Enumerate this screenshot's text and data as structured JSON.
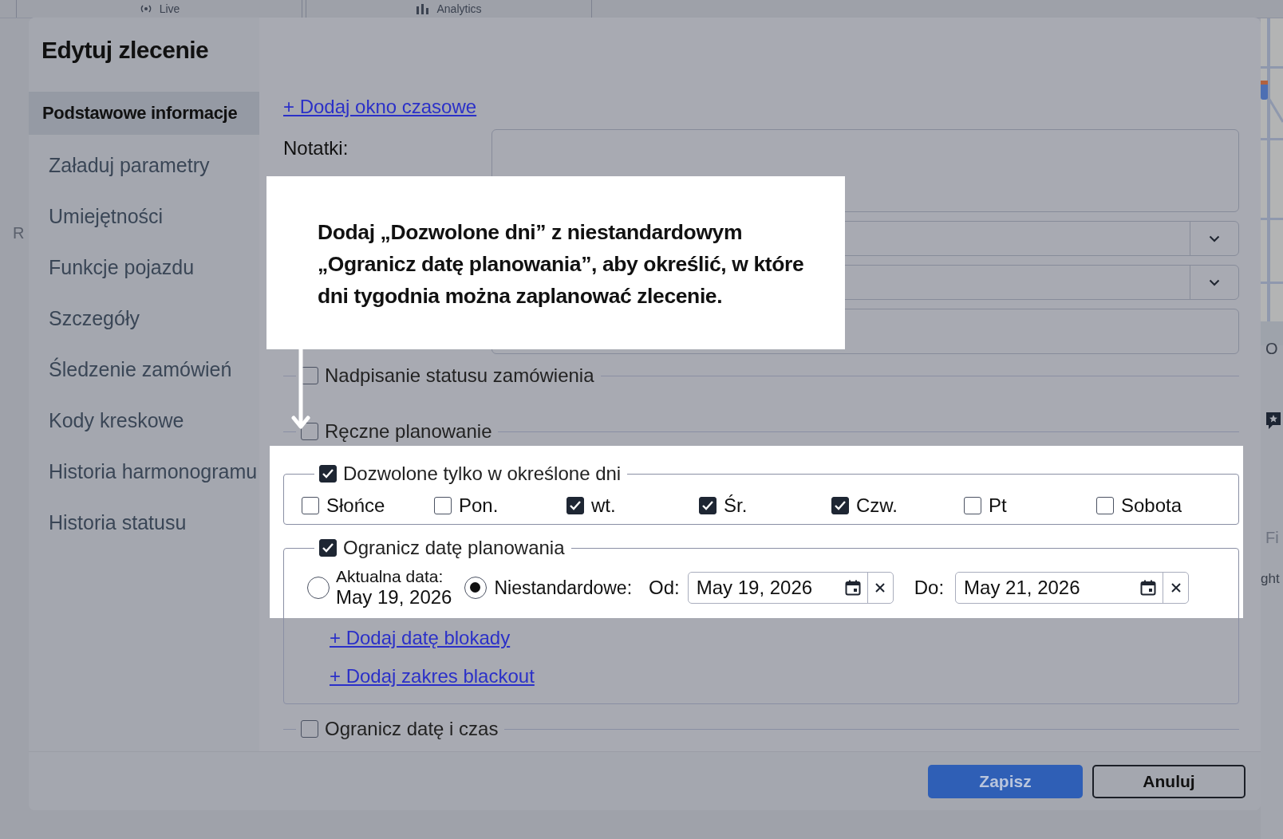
{
  "background": {
    "tabs": [
      {
        "label": "Live"
      },
      {
        "label": "Analytics"
      }
    ],
    "left_fragments": [
      "R"
    ],
    "right_fragments": [
      "O",
      "Fi",
      "ght"
    ]
  },
  "dialog": {
    "title": "Edytuj zlecenie",
    "sidebar": {
      "items": [
        {
          "label": "Podstawowe informacje",
          "selected": true
        },
        {
          "label": "Załaduj parametry",
          "selected": false
        },
        {
          "label": "Umiejętności",
          "selected": false
        },
        {
          "label": "Funkcje pojazdu",
          "selected": false
        },
        {
          "label": "Szczegóły",
          "selected": false
        },
        {
          "label": "Śledzenie zamówień",
          "selected": false
        },
        {
          "label": "Kody kreskowe",
          "selected": false
        },
        {
          "label": "Historia harmonogramu",
          "selected": false
        },
        {
          "label": "Historia statusu",
          "selected": false
        }
      ]
    },
    "add_time_window": "+ Dodaj okno czasowe",
    "notes_label": "Notatki:",
    "fields": [
      {
        "kind": "select"
      },
      {
        "kind": "select"
      },
      {
        "kind": "input"
      }
    ],
    "sections": [
      {
        "kind": "plain",
        "label": "Nadpisanie statusu zamówienia",
        "checked": false
      },
      {
        "kind": "plain",
        "label": "Ręczne planowanie",
        "checked": false
      },
      {
        "kind": "days",
        "label": "Dozwolone tylko w określone dni",
        "checked": true,
        "days": [
          {
            "label": "Słońce",
            "checked": false
          },
          {
            "label": "Pon.",
            "checked": false
          },
          {
            "label": "wt.",
            "checked": true
          },
          {
            "label": "Śr.",
            "checked": true
          },
          {
            "label": "Czw.",
            "checked": true
          },
          {
            "label": "Pt",
            "checked": false
          },
          {
            "label": "Sobota",
            "checked": false
          }
        ]
      },
      {
        "kind": "date_limit",
        "label": "Ogranicz datę planowania",
        "checked": true,
        "options": [
          {
            "label": "Aktualna data:",
            "date": "May 19, 2026",
            "selected": false
          },
          {
            "label": "Niestandardowe:",
            "selected": true
          }
        ],
        "range": {
          "from_label": "Od:",
          "from": "May 19, 2026",
          "to_label": "Do:",
          "to": "May 21, 2026"
        },
        "links": [
          "+ Dodaj datę blokady",
          "+ Dodaj zakres blackout"
        ]
      },
      {
        "kind": "plain",
        "label": "Ogranicz datę i czas",
        "checked": false
      }
    ],
    "buttons": [
      {
        "label": "Zapisz",
        "kind": "primary"
      },
      {
        "label": "Anuluj",
        "kind": "secondary"
      }
    ]
  },
  "callout": {
    "text": "Dodaj „Dozwolone dni” z niestandardowym „Ogranicz datę planowania”, aby określić, w które dni tygodnia można zaplanować zlecenie."
  }
}
